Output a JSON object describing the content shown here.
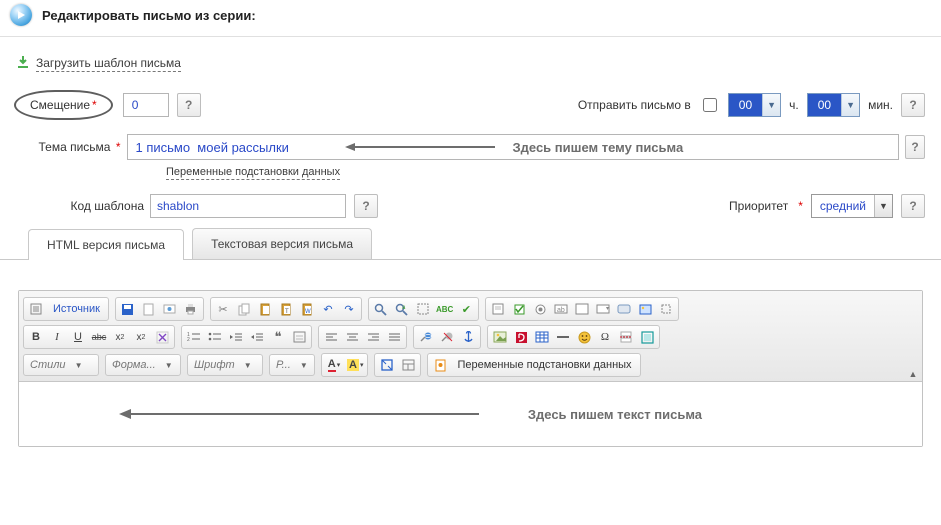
{
  "header": {
    "title": "Редактировать письмо из серии:"
  },
  "load_template_link": "Загрузить шаблон письма",
  "offset": {
    "label": "Смещение",
    "value": "0",
    "help": "?"
  },
  "send_at": {
    "label": "Отправить письмо в",
    "hours": "00",
    "h_unit": "ч.",
    "minutes": "00",
    "m_unit": "мин.",
    "help": "?"
  },
  "subject": {
    "label": "Тема письма",
    "value": "1 письмо  моей рассылки",
    "hint": "Здесь пишем тему  письма",
    "vars_link": "Переменные подстановки данных",
    "help": "?"
  },
  "template_code": {
    "label": "Код шаблона",
    "value": "shablon",
    "help": "?"
  },
  "priority": {
    "label": "Приоритет",
    "value": "средний",
    "help": "?"
  },
  "tabs": {
    "html": "HTML версия письма",
    "text": "Текстовая версия письма"
  },
  "editor": {
    "source_btn": "Источник",
    "style_combo": "Стили",
    "format_combo": "Форма...",
    "font_combo": "Шрифт",
    "size_combo": "Р...",
    "vars_btn": "Переменные подстановки данных",
    "body_hint": "Здесь пишем  текст письма"
  }
}
